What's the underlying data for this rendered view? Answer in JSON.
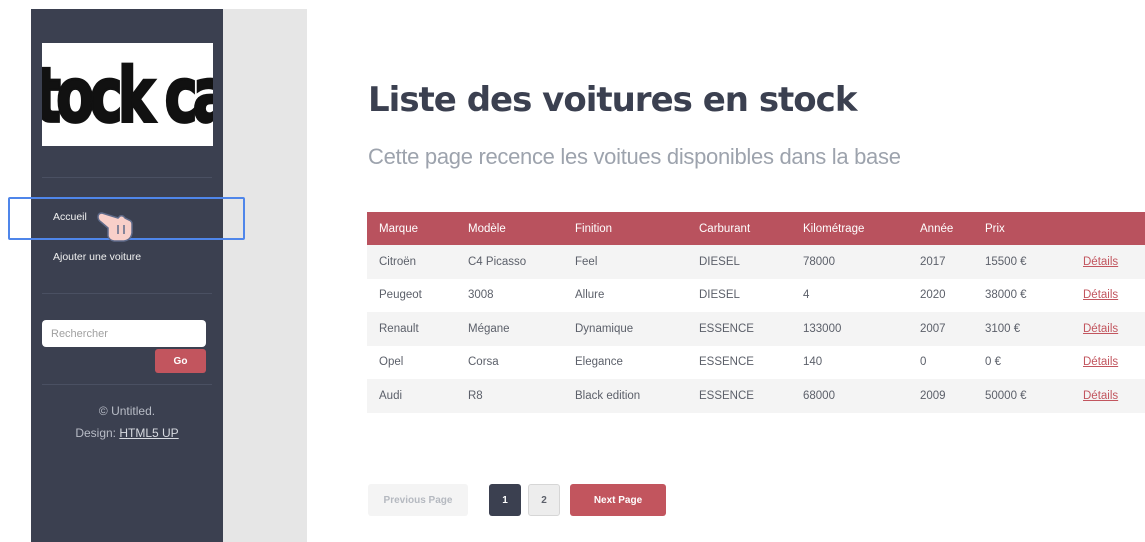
{
  "sidebar": {
    "logo_text": "stock car",
    "nav": [
      "Accueil",
      "Ajouter une voiture"
    ],
    "search_placeholder": "Rechercher",
    "go_label": "Go",
    "footer_copyright": "© Untitled.",
    "footer_design_label": "Design:",
    "footer_design_link": "HTML5 UP"
  },
  "main": {
    "title": "Liste des voitures en stock",
    "subtitle": "Cette page recence les voitues disponibles dans la base"
  },
  "table": {
    "headers": [
      "Marque",
      "Modèle",
      "Finition",
      "Carburant",
      "Kilométrage",
      "Année",
      "Prix",
      ""
    ],
    "rows": [
      [
        "Citroën",
        "C4 Picasso",
        "Feel",
        "DIESEL",
        "78000",
        "2017",
        "15500 €",
        "Détails"
      ],
      [
        "Peugeot",
        "3008",
        "Allure",
        "DIESEL",
        "4",
        "2020",
        "38000 €",
        "Détails"
      ],
      [
        "Renault",
        "Mégane",
        "Dynamique",
        "ESSENCE",
        "133000",
        "2007",
        "3100 €",
        "Détails"
      ],
      [
        "Opel",
        "Corsa",
        "Elegance",
        "ESSENCE",
        "140",
        "0",
        "0 €",
        "Détails"
      ],
      [
        "Audi",
        "R8",
        "Black edition",
        "ESSENCE",
        "68000",
        "2009",
        "50000 €",
        "Détails"
      ]
    ]
  },
  "pagination": {
    "previous": "Previous Page",
    "pages": [
      "1",
      "2"
    ],
    "next": "Next Page"
  },
  "colors": {
    "sidebar": "#3b4050",
    "accent": "#c2555e",
    "table_header": "#b9525e",
    "highlight": "#4f86ea"
  },
  "icons": {
    "logo": "stock-car-logo",
    "cursor": "pointing-hand-cursor-icon"
  }
}
